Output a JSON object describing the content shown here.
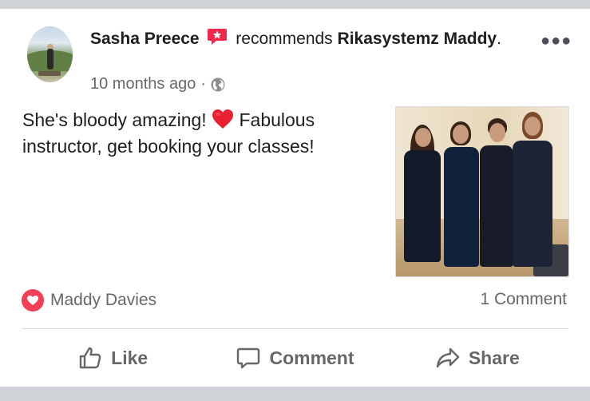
{
  "post": {
    "author": "Sasha Preece",
    "action_text": "recommends",
    "target_page": "Rikasystemz Maddy",
    "target_suffix": ".",
    "timestamp": "10 months ago",
    "separator": "·",
    "audience_icon": "globe-icon",
    "text_before_emoji": "She's bloody amazing!",
    "emoji": "red-heart",
    "text_after_emoji": "Fabulous instructor, get booking your classes!"
  },
  "reactions": {
    "icon": "love-reaction-icon",
    "names": "Maddy Davies",
    "comment_count": "1 Comment"
  },
  "actions": {
    "like": "Like",
    "comment": "Comment",
    "share": "Share"
  },
  "colors": {
    "recommend_red": "#f0284a",
    "love_red": "#f33e58",
    "secondary_text": "#65676b",
    "primary_text": "#1c1e21",
    "separator_gray": "#cfd3d8"
  }
}
